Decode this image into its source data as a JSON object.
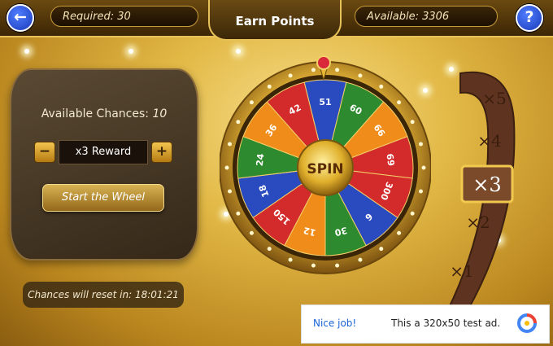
{
  "header": {
    "required": "Required: 30",
    "title": "Earn Points",
    "available": "Available: 3306",
    "back_glyph": "←",
    "help_glyph": "?"
  },
  "panel": {
    "chances_label": "Available Chances:",
    "chances_value": "10",
    "minus": "−",
    "plus": "+",
    "reward": "x3 Reward",
    "start": "Start the Wheel"
  },
  "reset_text": "Chances will reset in: 18:01:21",
  "wheel": {
    "center_label": "SPIN",
    "segments": [
      {
        "label": "51",
        "color": "#2a4bbf"
      },
      {
        "label": "60",
        "color": "#2e8a2e"
      },
      {
        "label": "66",
        "color": "#f08d1a"
      },
      {
        "label": "69",
        "color": "#d32b2b"
      },
      {
        "label": "300",
        "color": "#d32b2b"
      },
      {
        "label": "6",
        "color": "#2a4bbf"
      },
      {
        "label": "30",
        "color": "#2e8a2e"
      },
      {
        "label": "12",
        "color": "#f08d1a"
      },
      {
        "label": "150",
        "color": "#d32b2b"
      },
      {
        "label": "18",
        "color": "#2a4bbf"
      },
      {
        "label": "24",
        "color": "#2e8a2e"
      },
      {
        "label": "36",
        "color": "#f08d1a"
      },
      {
        "label": "42",
        "color": "#d32b2b"
      }
    ]
  },
  "multiplier": {
    "labels": [
      "×5",
      "×4",
      "×3",
      "×2",
      "×1"
    ],
    "selected": "×3"
  },
  "ad": {
    "nice": "Nice job!",
    "text": "This a 320x50 test ad."
  },
  "colors": {
    "gold": "#e7c25a",
    "blue_button": "#1a3bb8"
  }
}
